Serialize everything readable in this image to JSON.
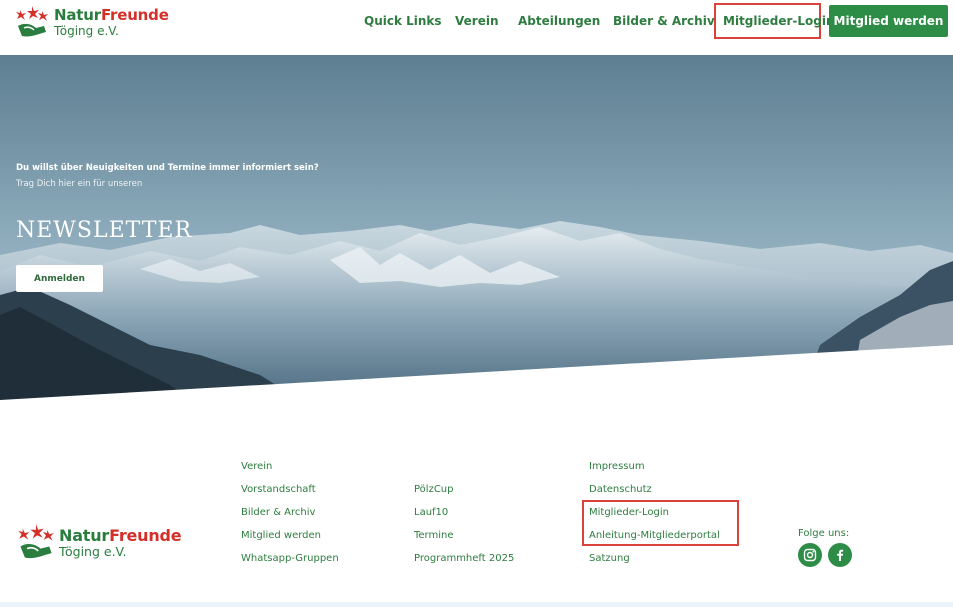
{
  "header": {
    "logo": {
      "brand_part1": "Natur",
      "brand_part2": "Freunde",
      "subtitle": "Töging e.V."
    },
    "nav": [
      {
        "label": "Quick Links"
      },
      {
        "label": "Verein"
      },
      {
        "label": "Abteilungen"
      },
      {
        "label": "Bilder & Archiv"
      },
      {
        "label": "Mitglieder-Login"
      }
    ],
    "cta_label": "Mitglied werden"
  },
  "hero": {
    "question": "Du willst über Neuigkeiten und Termine immer informiert sein?",
    "subline": "Trag Dich hier ein für unseren",
    "title": "NEWSLETTER",
    "button_label": "Anmelden"
  },
  "footer": {
    "logo": {
      "brand_part1": "Natur",
      "brand_part2": "Freunde",
      "subtitle": "Töging e.V."
    },
    "col1": [
      "Verein",
      "Vorstandschaft",
      "Bilder & Archiv",
      "Mitglied werden",
      "Whatsapp-Gruppen"
    ],
    "col2": [
      "PölzCup",
      "Lauf10",
      "Termine",
      "Programmheft 2025"
    ],
    "col3": [
      "Impressum",
      "Datenschutz",
      "Mitglieder-Login",
      "Anleitung-Mitgliederportal",
      "Satzung"
    ],
    "social_heading": "Folge uns:",
    "social_icons": [
      "instagram-icon",
      "facebook-icon"
    ]
  },
  "colors": {
    "brand_green": "#2d8d46",
    "brand_red": "#d4302a",
    "highlight_box": "#d9413a"
  }
}
